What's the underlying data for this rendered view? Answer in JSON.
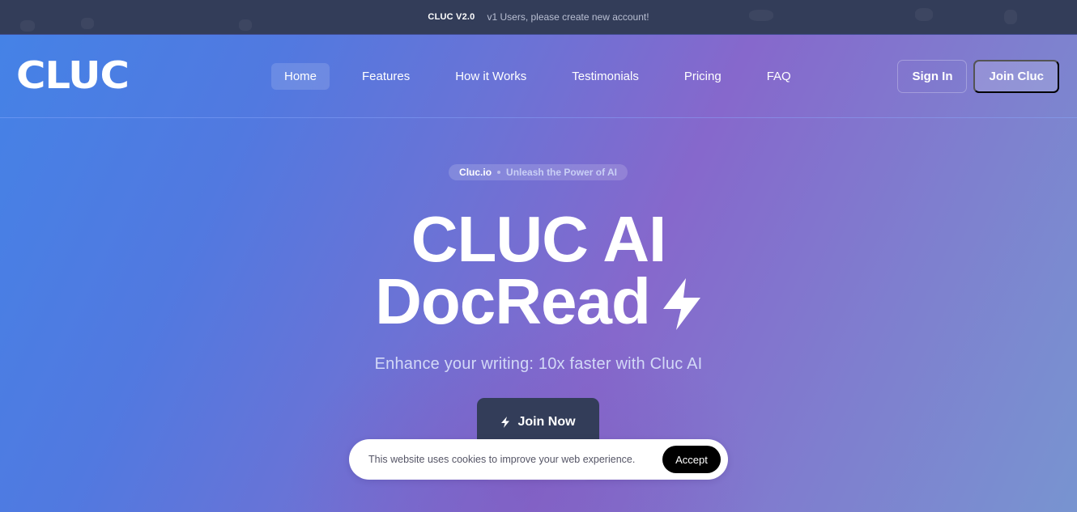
{
  "announcement": {
    "version": "CLUC V2.0",
    "message": "v1 Users, please create new account!"
  },
  "nav": {
    "logo": "CLUC",
    "links": [
      {
        "label": "Home",
        "active": true
      },
      {
        "label": "Features",
        "active": false
      },
      {
        "label": "How it Works",
        "active": false
      },
      {
        "label": "Testimonials",
        "active": false
      },
      {
        "label": "Pricing",
        "active": false
      },
      {
        "label": "FAQ",
        "active": false
      }
    ],
    "sign_in_label": "Sign In",
    "join_label": "Join Cluc"
  },
  "hero": {
    "pill_brand": "Cluc.io",
    "pill_tagline": "Unleash the Power of AI",
    "headline_line1": "CLUC AI",
    "headline_line2": "DocRead",
    "headline_icon": "lightning-bolt-icon",
    "subtitle": "Enhance your writing: 10x faster with Cluc AI",
    "cta_label": "Join Now",
    "cta_icon": "lightning-bolt-icon"
  },
  "cookie_banner": {
    "message": "This website uses cookies to improve your web experience.",
    "accept_label": "Accept"
  },
  "colors": {
    "announcement_bg": "#333d59",
    "gradient_blue": "#4582e6",
    "gradient_purple": "#8668cc",
    "cta_bg": "#333d59",
    "accept_bg": "#000000"
  }
}
